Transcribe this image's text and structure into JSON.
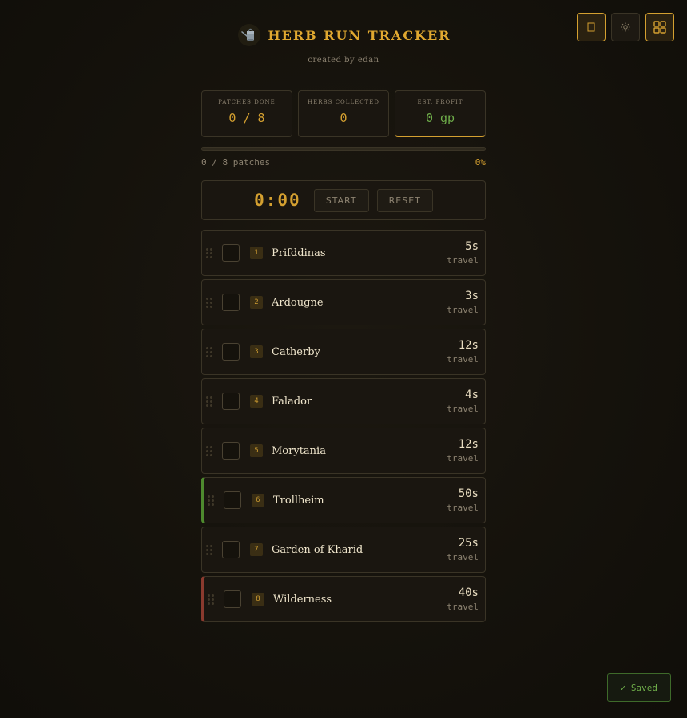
{
  "app": {
    "title": "HERB RUN TRACKER",
    "subtitle": "created by edan",
    "logo_icon": "watering-can-icon"
  },
  "top_controls": {
    "buttons": [
      {
        "icon": "focus-mode-icon",
        "active": true
      },
      {
        "icon": "sun-icon",
        "active": false
      },
      {
        "icon": "grid-icon",
        "active": true
      }
    ]
  },
  "stats": {
    "patches_done_label": "PATCHES DONE",
    "patches_done_value": "0 / 8",
    "herbs_collected_label": "HERBS COLLECTED",
    "herbs_collected_value": "0",
    "est_profit_label": "EST. PROFIT",
    "est_profit_value": "0 gp"
  },
  "progress": {
    "text": "0 / 8 patches",
    "percent_text": "0%",
    "fraction": 0
  },
  "timer": {
    "value": "0:00",
    "start_label": "START",
    "reset_label": "RESET"
  },
  "patches": [
    {
      "number": "1",
      "name": "Prifddinas",
      "time": "5s",
      "time_label": "travel",
      "edge": "none"
    },
    {
      "number": "2",
      "name": "Ardougne",
      "time": "3s",
      "time_label": "travel",
      "edge": "none"
    },
    {
      "number": "3",
      "name": "Catherby",
      "time": "12s",
      "time_label": "travel",
      "edge": "none"
    },
    {
      "number": "4",
      "name": "Falador",
      "time": "4s",
      "time_label": "travel",
      "edge": "none"
    },
    {
      "number": "5",
      "name": "Morytania",
      "time": "12s",
      "time_label": "travel",
      "edge": "none"
    },
    {
      "number": "6",
      "name": "Trollheim",
      "time": "50s",
      "time_label": "travel",
      "edge": "green"
    },
    {
      "number": "7",
      "name": "Garden of Kharid",
      "time": "25s",
      "time_label": "travel",
      "edge": "none"
    },
    {
      "number": "8",
      "name": "Wilderness",
      "time": "40s",
      "time_label": "travel",
      "edge": "red"
    }
  ],
  "toast": {
    "text": "✓ Saved"
  },
  "colors": {
    "accent": "#d4a030",
    "profit_green": "#6fae4a",
    "edge_green": "#4e8a2e",
    "edge_red": "#8a3a2e",
    "background": "#15120c"
  }
}
